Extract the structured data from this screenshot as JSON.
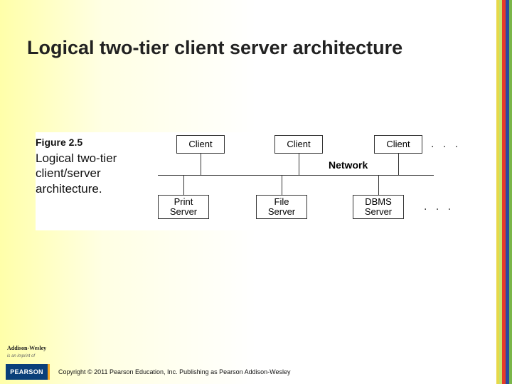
{
  "slide": {
    "title": "Logical two-tier client server architecture"
  },
  "figure": {
    "number": "Figure 2.5",
    "caption": "Logical two-tier client/server architecture.",
    "clients": [
      "Client",
      "Client",
      "Client"
    ],
    "network_label": "Network",
    "servers": [
      "Print\nServer",
      "File\nServer",
      "DBMS\nServer"
    ],
    "ellipsis_top": ". . .",
    "ellipsis_bottom": ". . ."
  },
  "footer": {
    "imprint": "Addison-Wesley",
    "imprint_sub": "is an imprint of",
    "publisher": "PEARSON",
    "copyright": "Copyright © 2011 Pearson Education, Inc. Publishing as Pearson Addison-Wesley"
  }
}
